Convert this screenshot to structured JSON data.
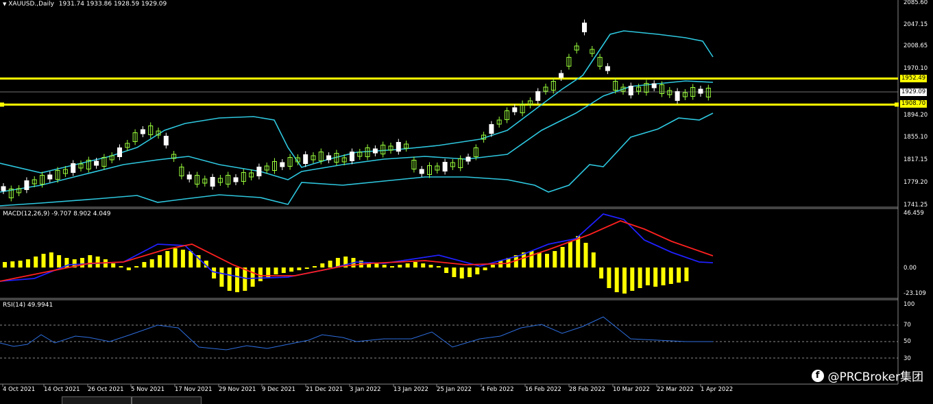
{
  "main_chart": {
    "symbol_line": "XAUUSD.,Daily",
    "ohlc": "1931.74 1933.86 1928.59 1929.09",
    "price_ticks": [
      "2085.60",
      "2047.15",
      "2008.65",
      "1970.10",
      "1929.09",
      "1894.20",
      "1855.10",
      "1817.15",
      "1779.20",
      "1741.25"
    ],
    "tag_upper": "1952.49",
    "tag_current": "1929.09",
    "tag_lower": "1908.70",
    "colors": {
      "level_line": "#ffff00",
      "bollinger": "#2ec8e0",
      "bull_candle": "#9aff3c",
      "bear_candle": "#ffffff"
    }
  },
  "macd_panel": {
    "label": "MACD(12,26,9) -9.707 8.902 4.049",
    "ticks": [
      "46.459",
      "0.00",
      "-23.109"
    ],
    "colors": {
      "histogram": "#ffff00",
      "signal": "#ff2020",
      "macd": "#2020ff"
    }
  },
  "rsi_panel": {
    "label": "RSI(14) 49.9941",
    "ticks": [
      "100",
      "70",
      "50",
      "30"
    ],
    "colors": {
      "line": "#2e6fe0"
    }
  },
  "time_axis": [
    "4 Oct 2021",
    "14 Oct 2021",
    "26 Oct 2021",
    "5 Nov 2021",
    "17 Nov 2021",
    "29 Nov 2021",
    "9 Dec 2021",
    "21 Dec 2021",
    "3 Jan 2022",
    "13 Jan 2022",
    "25 Jan 2022",
    "4 Feb 2022",
    "16 Feb 2022",
    "28 Feb 2022",
    "10 Mar 2022",
    "22 Mar 2022",
    "1 Apr 2022"
  ],
  "watermark": "@PRCBroker集团",
  "watermark_icon": "facebook-icon"
}
